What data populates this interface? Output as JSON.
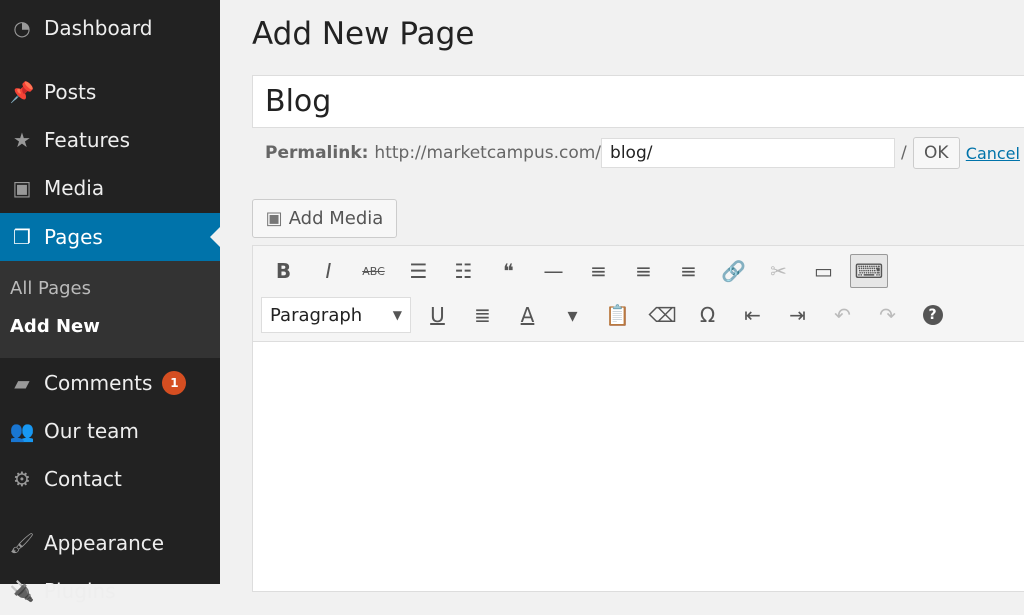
{
  "sidebar": {
    "items": [
      {
        "label": "Dashboard",
        "icon": "dashboard-icon",
        "glyph": "◔"
      },
      {
        "label": "Posts",
        "icon": "pin-icon",
        "glyph": "📌"
      },
      {
        "label": "Features",
        "icon": "star-icon",
        "glyph": "★"
      },
      {
        "label": "Media",
        "icon": "media-icon",
        "glyph": "▣"
      },
      {
        "label": "Pages",
        "icon": "pages-icon",
        "glyph": "❐"
      },
      {
        "label": "Comments",
        "icon": "comment-icon",
        "glyph": "▰",
        "badge": "1"
      },
      {
        "label": "Our team",
        "icon": "team-icon",
        "glyph": "👥"
      },
      {
        "label": "Contact",
        "icon": "gear-icon",
        "glyph": "⚙"
      },
      {
        "label": "Appearance",
        "icon": "brush-icon",
        "glyph": "🖌"
      },
      {
        "label": "Plugins",
        "icon": "plugin-icon",
        "glyph": "🔌"
      }
    ],
    "submenu": [
      "All Pages",
      "Add New"
    ]
  },
  "page": {
    "heading": "Add New Page",
    "title_value": "Blog",
    "permalink_label": "Permalink:",
    "permalink_base": "http://marketcampus.com/",
    "slug": "blog/",
    "slash": "/",
    "ok": "OK",
    "cancel": "Cancel",
    "add_media": "Add Media"
  },
  "toolbar": {
    "row1": [
      {
        "n": "bold",
        "g": "B"
      },
      {
        "n": "italic",
        "g": "I"
      },
      {
        "n": "strikethrough",
        "g": "ABC"
      },
      {
        "n": "bullet-list",
        "g": "☰"
      },
      {
        "n": "numbered-list",
        "g": "☷"
      },
      {
        "n": "blockquote",
        "g": "❝"
      },
      {
        "n": "horizontal-line",
        "g": "—"
      },
      {
        "n": "align-left",
        "g": "≡"
      },
      {
        "n": "align-center",
        "g": "≡"
      },
      {
        "n": "align-right",
        "g": "≡"
      },
      {
        "n": "link",
        "g": "🔗",
        "dim": true
      },
      {
        "n": "unlink",
        "g": "✂",
        "dim": true
      },
      {
        "n": "read-more",
        "g": "▭"
      },
      {
        "n": "toolbar-toggle",
        "g": "⌨",
        "on": true
      }
    ],
    "format": "Paragraph",
    "row2": [
      {
        "n": "underline",
        "g": "U"
      },
      {
        "n": "justify",
        "g": "≣"
      },
      {
        "n": "text-color",
        "g": "A"
      },
      {
        "n": "text-color-dropdown",
        "g": "▾"
      },
      {
        "n": "paste-text",
        "g": "📋"
      },
      {
        "n": "clear-formatting",
        "g": "⌫"
      },
      {
        "n": "special-character",
        "g": "Ω"
      },
      {
        "n": "outdent",
        "g": "⇤"
      },
      {
        "n": "indent",
        "g": "⇥"
      },
      {
        "n": "undo",
        "g": "↶",
        "dim": true
      },
      {
        "n": "redo",
        "g": "↷",
        "dim": true
      },
      {
        "n": "help",
        "g": "?"
      }
    ]
  }
}
